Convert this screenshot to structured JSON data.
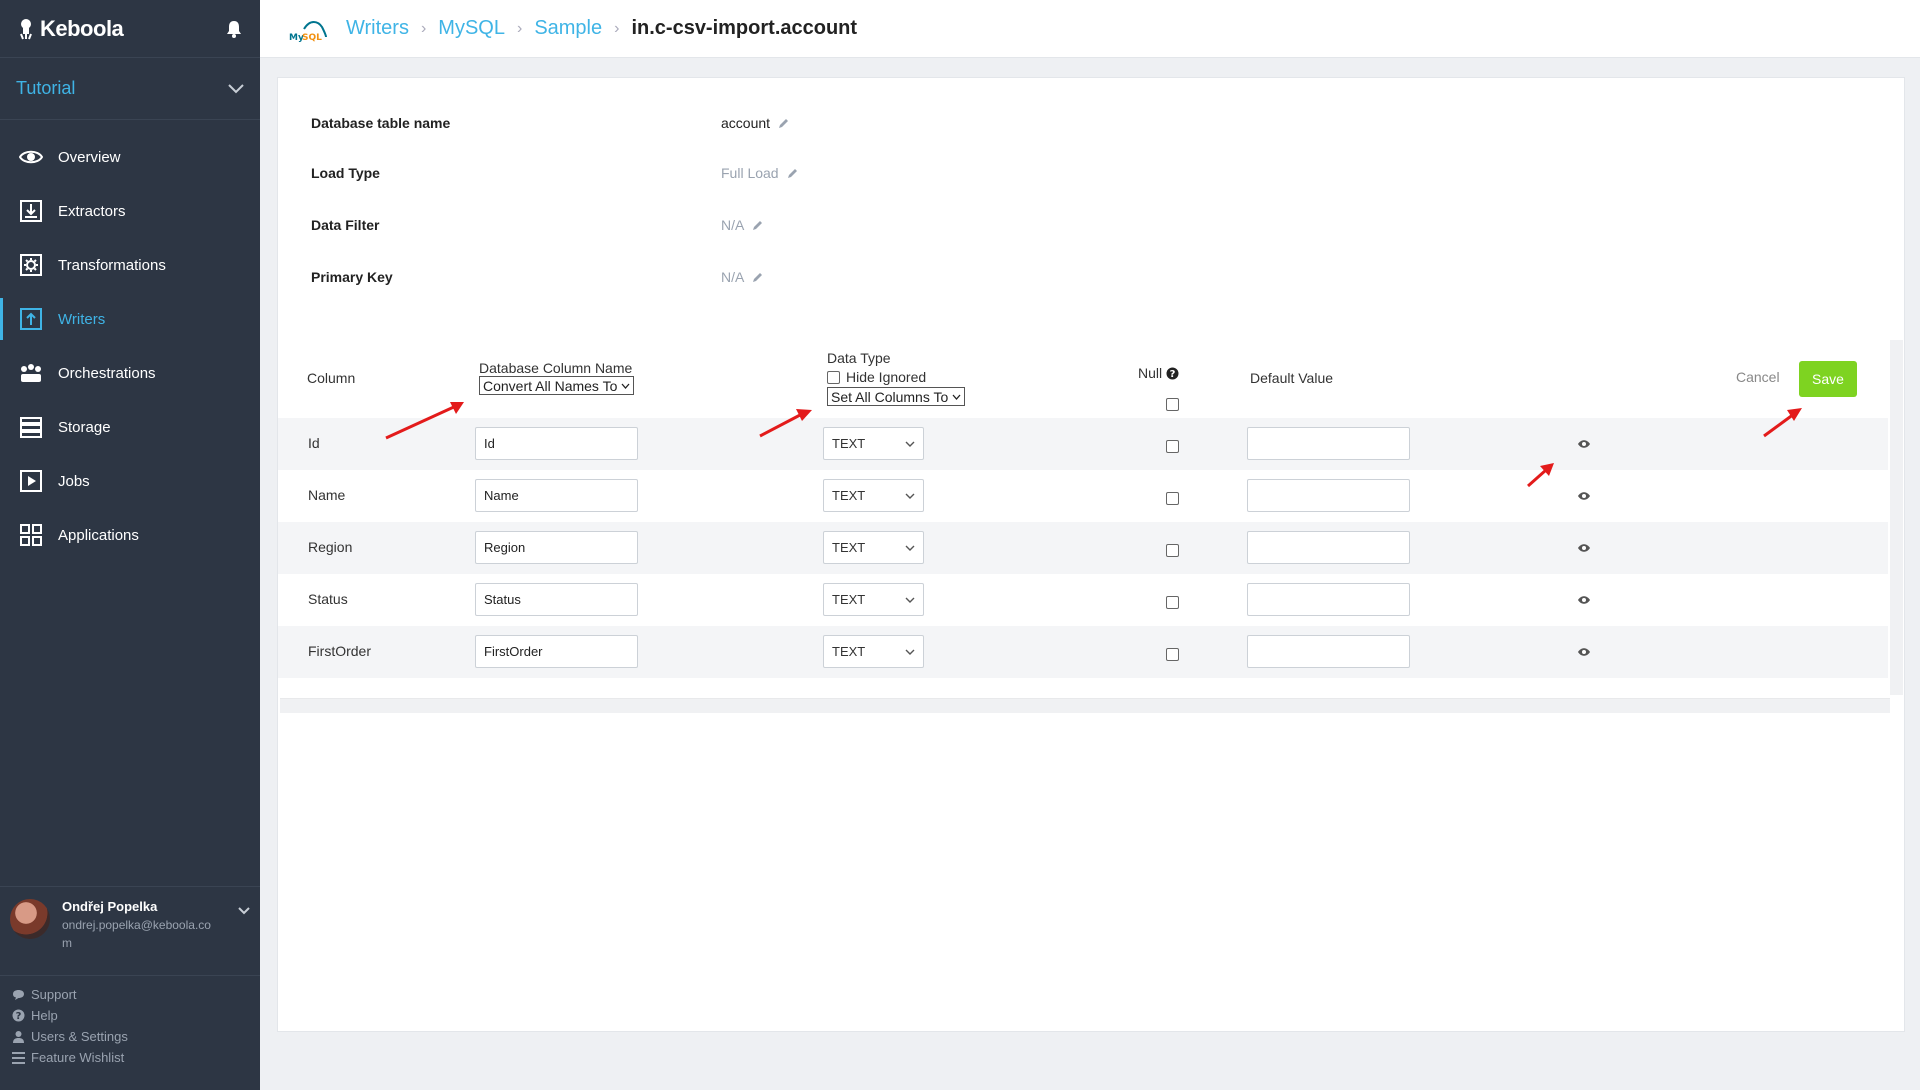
{
  "brand": {
    "name": "Keboola"
  },
  "project": {
    "name": "Tutorial"
  },
  "nav": [
    {
      "label": "Overview",
      "icon": "eye-icon"
    },
    {
      "label": "Extractors",
      "icon": "extract-icon"
    },
    {
      "label": "Transformations",
      "icon": "gear-icon"
    },
    {
      "label": "Writers",
      "icon": "upload-icon",
      "active": true
    },
    {
      "label": "Orchestrations",
      "icon": "orchestration-icon"
    },
    {
      "label": "Storage",
      "icon": "storage-icon"
    },
    {
      "label": "Jobs",
      "icon": "play-icon"
    },
    {
      "label": "Applications",
      "icon": "apps-icon"
    }
  ],
  "user": {
    "name": "Ondřej Popelka",
    "email": "ondrej.popelka@keboola.com"
  },
  "footer_links": [
    {
      "label": "Support",
      "icon": "chat-icon"
    },
    {
      "label": "Help",
      "icon": "help-icon"
    },
    {
      "label": "Users & Settings",
      "icon": "user-icon"
    },
    {
      "label": "Feature Wishlist",
      "icon": "list-icon"
    }
  ],
  "breadcrumb": {
    "items": [
      "Writers",
      "MySQL",
      "Sample"
    ],
    "current": "in.c-csv-import.account"
  },
  "props": [
    {
      "label": "Database table name",
      "value": "account",
      "muted": false
    },
    {
      "label": "Load Type",
      "value": "Full Load",
      "muted": true
    },
    {
      "label": "Data Filter",
      "value": "N/A",
      "muted": true
    },
    {
      "label": "Primary Key",
      "value": "N/A",
      "muted": true
    }
  ],
  "table": {
    "headers": {
      "column": "Column",
      "db_column_name": "Database Column Name",
      "convert_all": "Convert All Names To",
      "data_type": "Data Type",
      "hide_ignored": "Hide Ignored",
      "set_all_columns": "Set All Columns To",
      "null": "Null",
      "default_value": "Default Value"
    },
    "rows": [
      {
        "column": "Id",
        "db_name": "Id",
        "type": "TEXT",
        "default": ""
      },
      {
        "column": "Name",
        "db_name": "Name",
        "type": "TEXT",
        "default": ""
      },
      {
        "column": "Region",
        "db_name": "Region",
        "type": "TEXT",
        "default": ""
      },
      {
        "column": "Status",
        "db_name": "Status",
        "type": "TEXT",
        "default": ""
      },
      {
        "column": "FirstOrder",
        "db_name": "FirstOrder",
        "type": "TEXT",
        "default": ""
      }
    ]
  },
  "actions": {
    "cancel": "Cancel",
    "save": "Save"
  },
  "colors": {
    "accent": "#3fb4e6",
    "save": "#7ed321",
    "sidebar": "#2d3644",
    "arrow": "#e31b1b"
  }
}
